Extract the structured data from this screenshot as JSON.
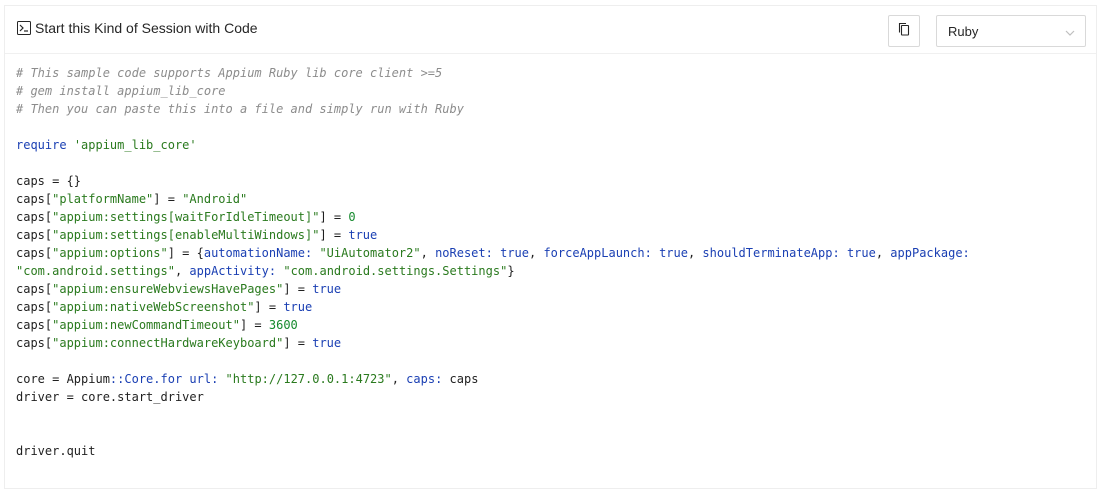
{
  "header": {
    "title": "Start this Kind of Session with Code",
    "title_icon": "terminal-icon",
    "copy_icon": "copy-icon",
    "language_select": {
      "value": "Ruby",
      "icon": "chevron-down-icon"
    }
  },
  "code": {
    "lines": [
      [
        {
          "t": "c",
          "v": "# This sample code supports Appium Ruby lib core client >=5"
        }
      ],
      [
        {
          "t": "c",
          "v": "# gem install appium_lib_core"
        }
      ],
      [
        {
          "t": "c",
          "v": "# Then you can paste this into a file and simply run with Ruby"
        }
      ],
      [],
      [
        {
          "t": "k",
          "v": "require"
        },
        {
          "t": "d",
          "v": " "
        },
        {
          "t": "s",
          "v": "'appium_lib_core'"
        }
      ],
      [],
      [
        {
          "t": "d",
          "v": "caps = {}"
        }
      ],
      [
        {
          "t": "d",
          "v": "caps["
        },
        {
          "t": "s",
          "v": "\"platformName\""
        },
        {
          "t": "d",
          "v": "] = "
        },
        {
          "t": "s",
          "v": "\"Android\""
        }
      ],
      [
        {
          "t": "d",
          "v": "caps["
        },
        {
          "t": "s",
          "v": "\"appium:settings[waitForIdleTimeout]\""
        },
        {
          "t": "d",
          "v": "] = "
        },
        {
          "t": "n",
          "v": "0"
        }
      ],
      [
        {
          "t": "d",
          "v": "caps["
        },
        {
          "t": "s",
          "v": "\"appium:settings[enableMultiWindows]\""
        },
        {
          "t": "d",
          "v": "] = "
        },
        {
          "t": "k",
          "v": "true"
        }
      ],
      [
        {
          "t": "d",
          "v": "caps["
        },
        {
          "t": "s",
          "v": "\"appium:options\""
        },
        {
          "t": "d",
          "v": "] = {"
        },
        {
          "t": "a",
          "v": "automationName:"
        },
        {
          "t": "d",
          "v": " "
        },
        {
          "t": "s",
          "v": "\"UiAutomator2\""
        },
        {
          "t": "d",
          "v": ", "
        },
        {
          "t": "a",
          "v": "noReset:"
        },
        {
          "t": "d",
          "v": " "
        },
        {
          "t": "k",
          "v": "true"
        },
        {
          "t": "d",
          "v": ", "
        },
        {
          "t": "a",
          "v": "forceAppLaunch:"
        },
        {
          "t": "d",
          "v": " "
        },
        {
          "t": "k",
          "v": "true"
        },
        {
          "t": "d",
          "v": ", "
        },
        {
          "t": "a",
          "v": "shouldTerminateApp:"
        },
        {
          "t": "d",
          "v": " "
        },
        {
          "t": "k",
          "v": "true"
        },
        {
          "t": "d",
          "v": ", "
        },
        {
          "t": "a",
          "v": "appPackage:"
        }
      ],
      [
        {
          "t": "s",
          "v": "\"com.android.settings\""
        },
        {
          "t": "d",
          "v": ", "
        },
        {
          "t": "a",
          "v": "appActivity:"
        },
        {
          "t": "d",
          "v": " "
        },
        {
          "t": "s",
          "v": "\"com.android.settings.Settings\""
        },
        {
          "t": "d",
          "v": "}"
        }
      ],
      [
        {
          "t": "d",
          "v": "caps["
        },
        {
          "t": "s",
          "v": "\"appium:ensureWebviewsHavePages\""
        },
        {
          "t": "d",
          "v": "] = "
        },
        {
          "t": "k",
          "v": "true"
        }
      ],
      [
        {
          "t": "d",
          "v": "caps["
        },
        {
          "t": "s",
          "v": "\"appium:nativeWebScreenshot\""
        },
        {
          "t": "d",
          "v": "] = "
        },
        {
          "t": "k",
          "v": "true"
        }
      ],
      [
        {
          "t": "d",
          "v": "caps["
        },
        {
          "t": "s",
          "v": "\"appium:newCommandTimeout\""
        },
        {
          "t": "d",
          "v": "] = "
        },
        {
          "t": "n",
          "v": "3600"
        }
      ],
      [
        {
          "t": "d",
          "v": "caps["
        },
        {
          "t": "s",
          "v": "\"appium:connectHardwareKeyboard\""
        },
        {
          "t": "d",
          "v": "] = "
        },
        {
          "t": "k",
          "v": "true"
        }
      ],
      [],
      [
        {
          "t": "d",
          "v": "core = Appium"
        },
        {
          "t": "a",
          "v": "::Core.for"
        },
        {
          "t": "d",
          "v": " "
        },
        {
          "t": "a",
          "v": "url:"
        },
        {
          "t": "d",
          "v": " "
        },
        {
          "t": "s",
          "v": "\"http://127.0.0.1:4723\""
        },
        {
          "t": "d",
          "v": ", "
        },
        {
          "t": "a",
          "v": "caps:"
        },
        {
          "t": "d",
          "v": " caps"
        }
      ],
      [
        {
          "t": "d",
          "v": "driver = core.start_driver"
        }
      ],
      [],
      [],
      [
        {
          "t": "d",
          "v": "driver.quit"
        }
      ]
    ]
  }
}
